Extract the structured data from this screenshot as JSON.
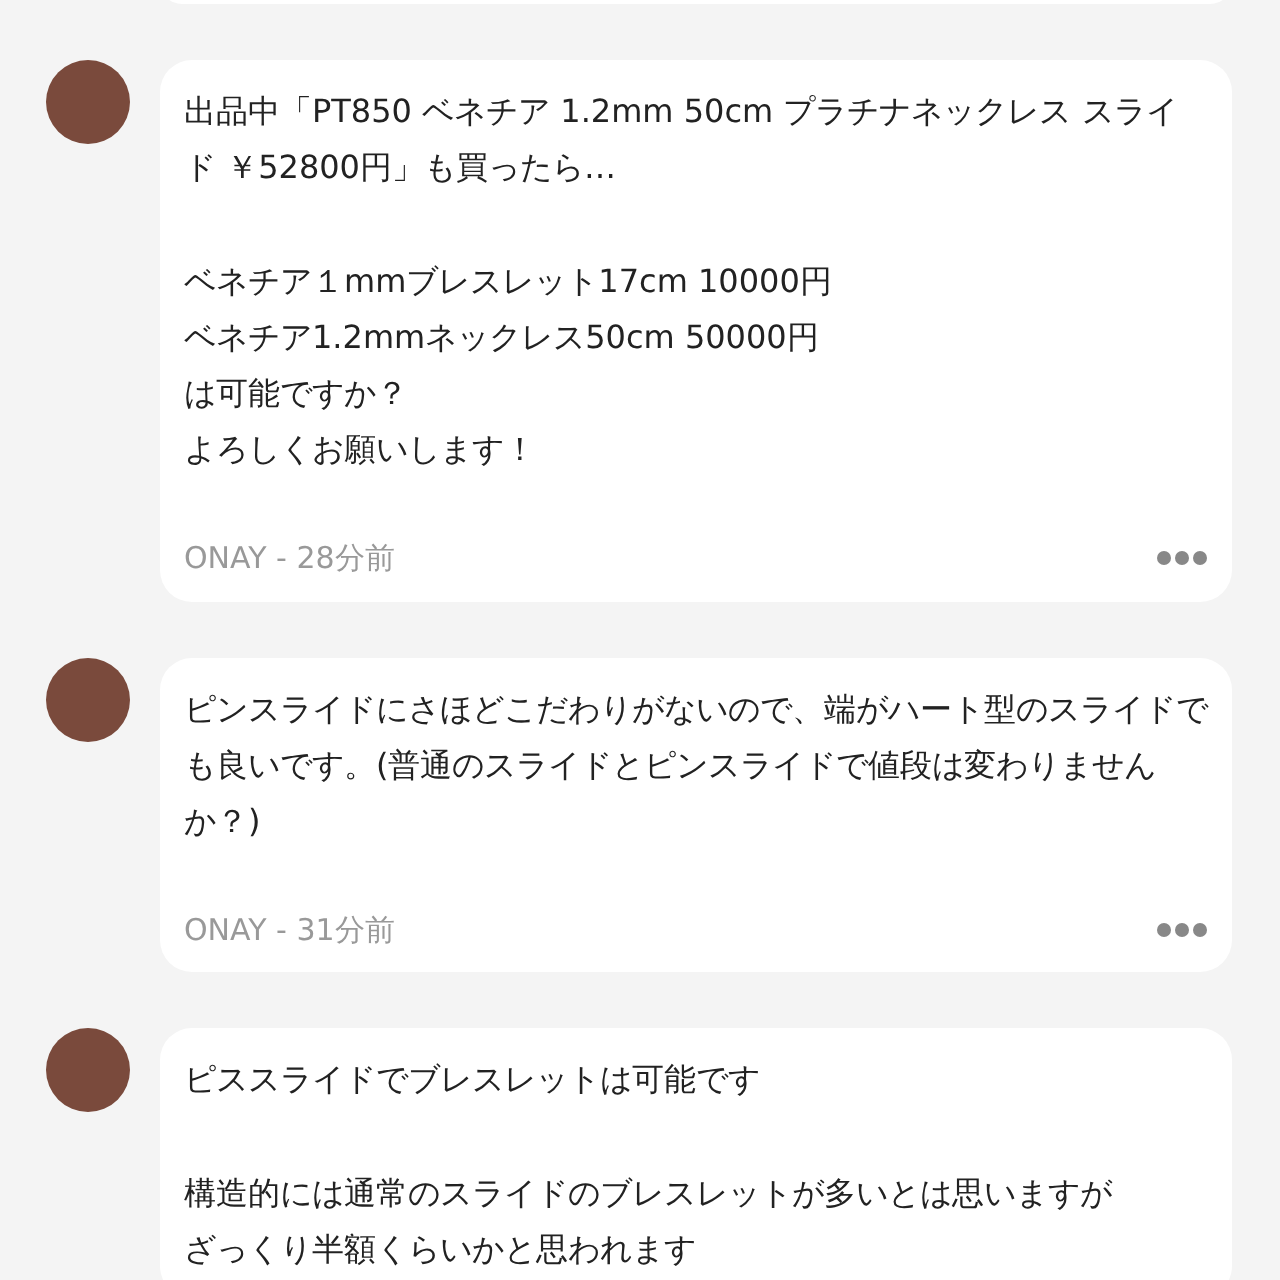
{
  "comments": [
    {
      "paragraphs": [
        [
          "出品中「PT850 ベネチア 1.2mm 50cm プラチナネックレス スライド ￥52800円」も買ったら…"
        ],
        [
          "ベネチア１mmブレスレット17cm 10000円",
          "ベネチア1.2mmネックレス50cm 50000円",
          "は可能ですか？",
          "よろしくお願いします！"
        ]
      ],
      "meta": "ONAY - 28分前"
    },
    {
      "paragraphs": [
        [
          "ピンスライドにさほどこだわりがないので、端がハート型のスライドでも良いです。(普通のスライドとピンスライドで値段は変わりませんか？)"
        ]
      ],
      "meta": "ONAY - 31分前"
    },
    {
      "paragraphs": [
        [
          "ピススライドでブレスレットは可能です"
        ],
        [
          "構造的には通常のスライドのブレスレットが多いとは思いますが",
          "ざっくり半額くらいかと思われます"
        ]
      ]
    }
  ]
}
